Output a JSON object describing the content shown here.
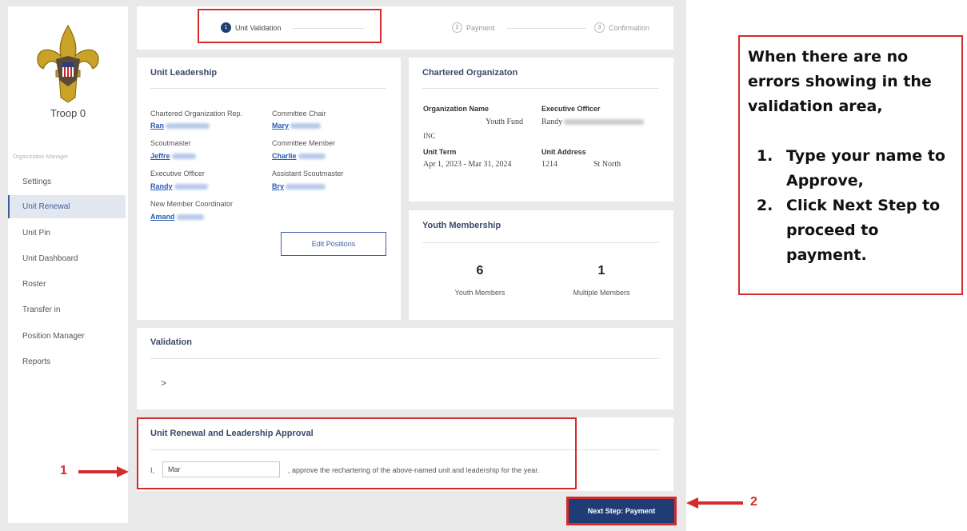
{
  "sidebar": {
    "troop": "Troop 0",
    "section": "Organization Manager",
    "items": [
      "Settings",
      "Unit Renewal",
      "Unit Pin",
      "Unit Dashboard",
      "Roster",
      "Transfer in",
      "Position Manager",
      "Reports"
    ],
    "active_item": "Unit Renewal"
  },
  "steps": [
    {
      "num": "1",
      "label": "Unit Validation"
    },
    {
      "num": "2",
      "label": "Payment"
    },
    {
      "num": "3",
      "label": "Confirmation"
    }
  ],
  "unit_leadership": {
    "title": "Unit Leadership",
    "positions": [
      {
        "role": "Chartered Organization Rep.",
        "name": "Ran"
      },
      {
        "role": "Committee Chair",
        "name": "Mary"
      },
      {
        "role": "Scoutmaster",
        "name": "Jeffre"
      },
      {
        "role": "Committee Member",
        "name": "Charlie"
      },
      {
        "role": "Executive Officer",
        "name": "Randy"
      },
      {
        "role": "Assistant Scoutmaster",
        "name": "Bry"
      },
      {
        "role": "New Member Coordinator",
        "name": "Amand"
      }
    ],
    "edit_button": "Edit Positions"
  },
  "chartered_org": {
    "title": "Chartered Organizaton",
    "org_name_label": "Organization Name",
    "org_name_value": "Youth Fund",
    "org_name_line2": "INC",
    "exec_label": "Executive Officer",
    "exec_value": "Randy",
    "term_label": "Unit Term",
    "term_value": "Apr 1, 2023 - Mar 31, 2024",
    "address_label": "Unit Address",
    "address_num": "1214",
    "address_street": "St North"
  },
  "youth_membership": {
    "title": "Youth Membership",
    "youth_count": "6",
    "youth_label": "Youth Members",
    "multiple_count": "1",
    "multiple_label": "Multiple Members"
  },
  "validation": {
    "title": "Validation",
    "chevron": ">"
  },
  "approval": {
    "title": "Unit Renewal and Leadership Approval",
    "prefix": "I,",
    "name_value": "Mar",
    "suffix": ", approve the rechartering of the above-named unit and leadership for the year."
  },
  "next_button": "Next Step: Payment",
  "annotations": {
    "marker1": "1",
    "marker2": "2",
    "note_intro": "When there are no errors showing in the validation area,",
    "note_steps": [
      "Type your name to Approve,",
      "Click Next Step to proceed to payment."
    ]
  },
  "colors": {
    "accent": "#1f3c75",
    "annotation_red": "#d62b2b",
    "link": "#2a5bb3"
  }
}
